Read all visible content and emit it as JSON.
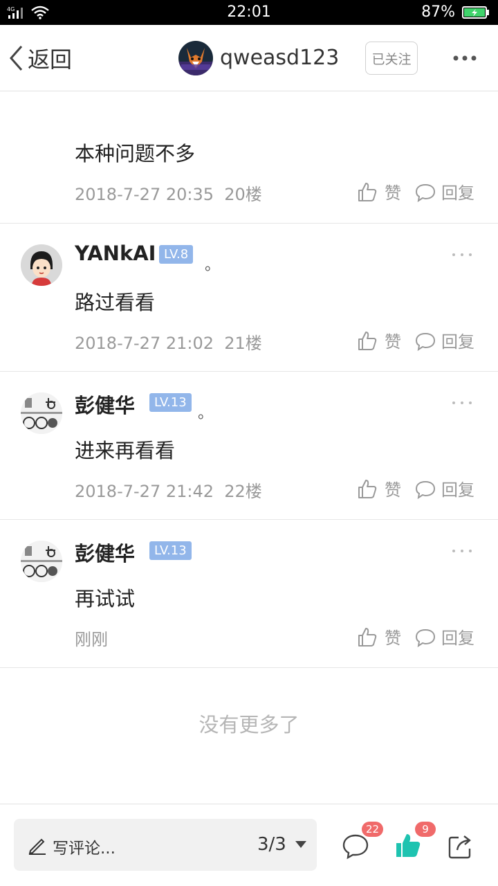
{
  "status_bar": {
    "network": "4G",
    "time": "22:01",
    "battery": "87%"
  },
  "header": {
    "back_label": "返回",
    "owner_name": "qweasd123",
    "follow_label": "已关注"
  },
  "comments": [
    {
      "text": "本种问题不多",
      "date": "2018-7-27 20:35",
      "floor": "20楼",
      "like_label": "赞",
      "reply_label": "回复"
    },
    {
      "name": "YANkAI",
      "level": "LV.8",
      "dot": "。",
      "text": "路过看看",
      "date": "2018-7-27 21:02",
      "floor": "21楼",
      "like_label": "赞",
      "reply_label": "回复"
    },
    {
      "name": "彭健华",
      "level": "LV.13",
      "dot": "。",
      "text": "进来再看看",
      "date": "2018-7-27 21:42",
      "floor": "22楼",
      "like_label": "赞",
      "reply_label": "回复"
    },
    {
      "name": "彭健华",
      "level": "LV.13",
      "text": "再试试",
      "date": "刚刚",
      "like_label": "赞",
      "reply_label": "回复"
    }
  ],
  "footer_text": "没有更多了",
  "bottom_bar": {
    "compose_label": "写评论...",
    "page_indicator": "3/3",
    "comment_count": "22",
    "like_count": "9"
  },
  "colors": {
    "accent": "#1ec3b0",
    "badge": "#f06a6a",
    "level_badge": "#92b6ea"
  }
}
